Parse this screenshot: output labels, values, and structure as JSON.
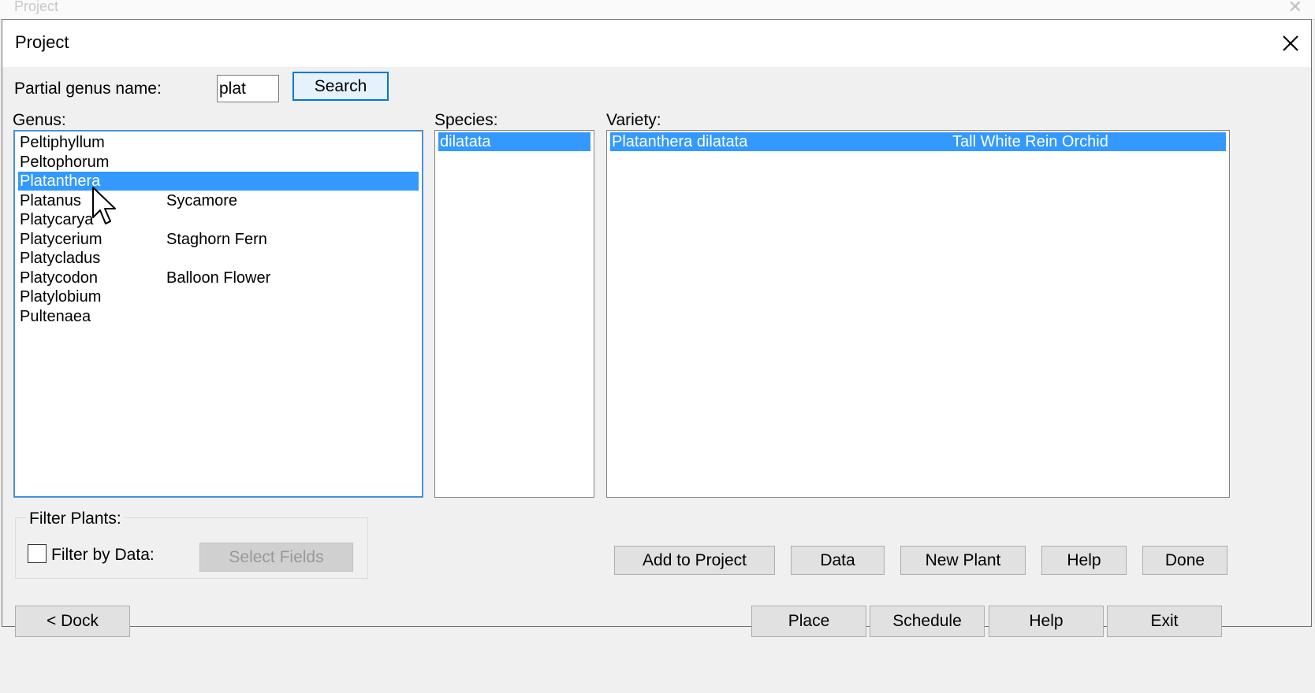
{
  "dialog": {
    "title": "Project",
    "partial_genus_label": "Partial genus name:",
    "partial_genus_value": "plat",
    "search_label": "Search",
    "genus_label": "Genus:",
    "species_label": "Species:",
    "variety_label": "Variety:",
    "genus_items": [
      {
        "name": "Peltiphyllum",
        "common": ""
      },
      {
        "name": "Peltophorum",
        "common": ""
      },
      {
        "name": "Platanthera",
        "common": "",
        "selected": true
      },
      {
        "name": "Platanus",
        "common": "Sycamore"
      },
      {
        "name": "Platycarya",
        "common": ""
      },
      {
        "name": "Platycerium",
        "common": "Staghorn Fern"
      },
      {
        "name": "Platycladus",
        "common": ""
      },
      {
        "name": "Platycodon",
        "common": "Balloon Flower"
      },
      {
        "name": "Platylobium",
        "common": ""
      },
      {
        "name": "Pultenaea",
        "common": ""
      }
    ],
    "species_items": [
      {
        "name": "dilatata",
        "selected": true
      }
    ],
    "variety_items": [
      {
        "name": "Platanthera dilatata",
        "common": "Tall White Rein Orchid",
        "selected": true
      }
    ],
    "filter_group_label": "Filter Plants:",
    "filter_by_data_label": "Filter by Data:",
    "filter_by_data_checked": false,
    "select_fields_label": "Select Fields",
    "buttons": {
      "add_to_project": "Add to Project",
      "data": "Data",
      "new_plant": "New Plant",
      "help": "Help",
      "done": "Done"
    }
  },
  "bottom_bar": {
    "dock": "< Dock",
    "place": "Place",
    "schedule": "Schedule",
    "help": "Help",
    "exit": "Exit"
  },
  "background_window": {
    "title": "Project"
  }
}
